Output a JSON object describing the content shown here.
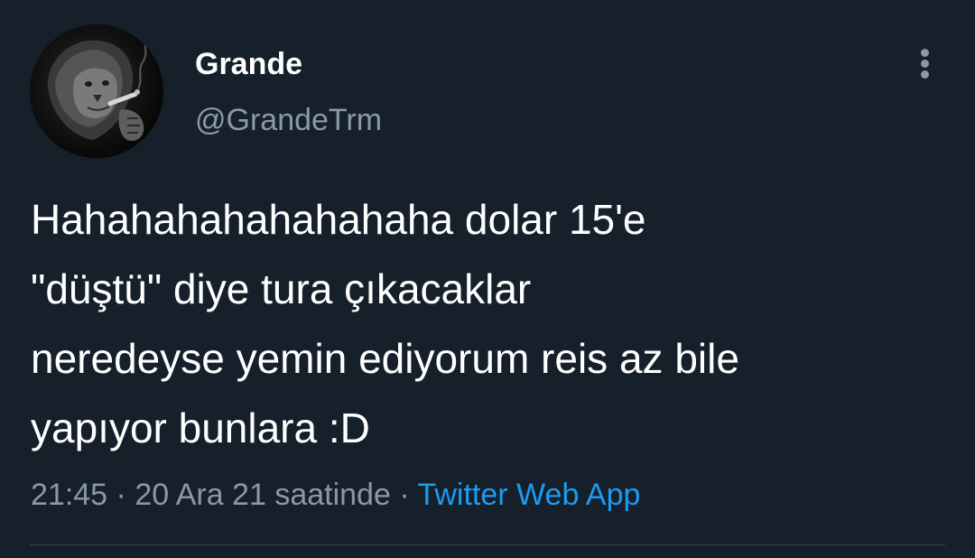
{
  "author": {
    "display_name": "Grande",
    "handle": "@GrandeTrm",
    "avatar_icon": "lion-smoking-avatar"
  },
  "tweet": {
    "text_lines": [
      "Hahahahahahahahaha dolar 15'e",
      "\"düştü\" diye tura çıkacaklar",
      "neredeyse yemin ediyorum reis az bile",
      "yapıyor bunlara :D"
    ],
    "time": "21:45",
    "date": "20 Ara 21 saatinde",
    "separator": " · ",
    "source": "Twitter Web App"
  },
  "menu": {
    "icon": "more-vertical-icon"
  },
  "colors": {
    "background": "#15202b",
    "primary_text": "#ffffff",
    "secondary_text": "#8b98a5",
    "link": "#1d9bf0",
    "divider": "#38444d"
  }
}
